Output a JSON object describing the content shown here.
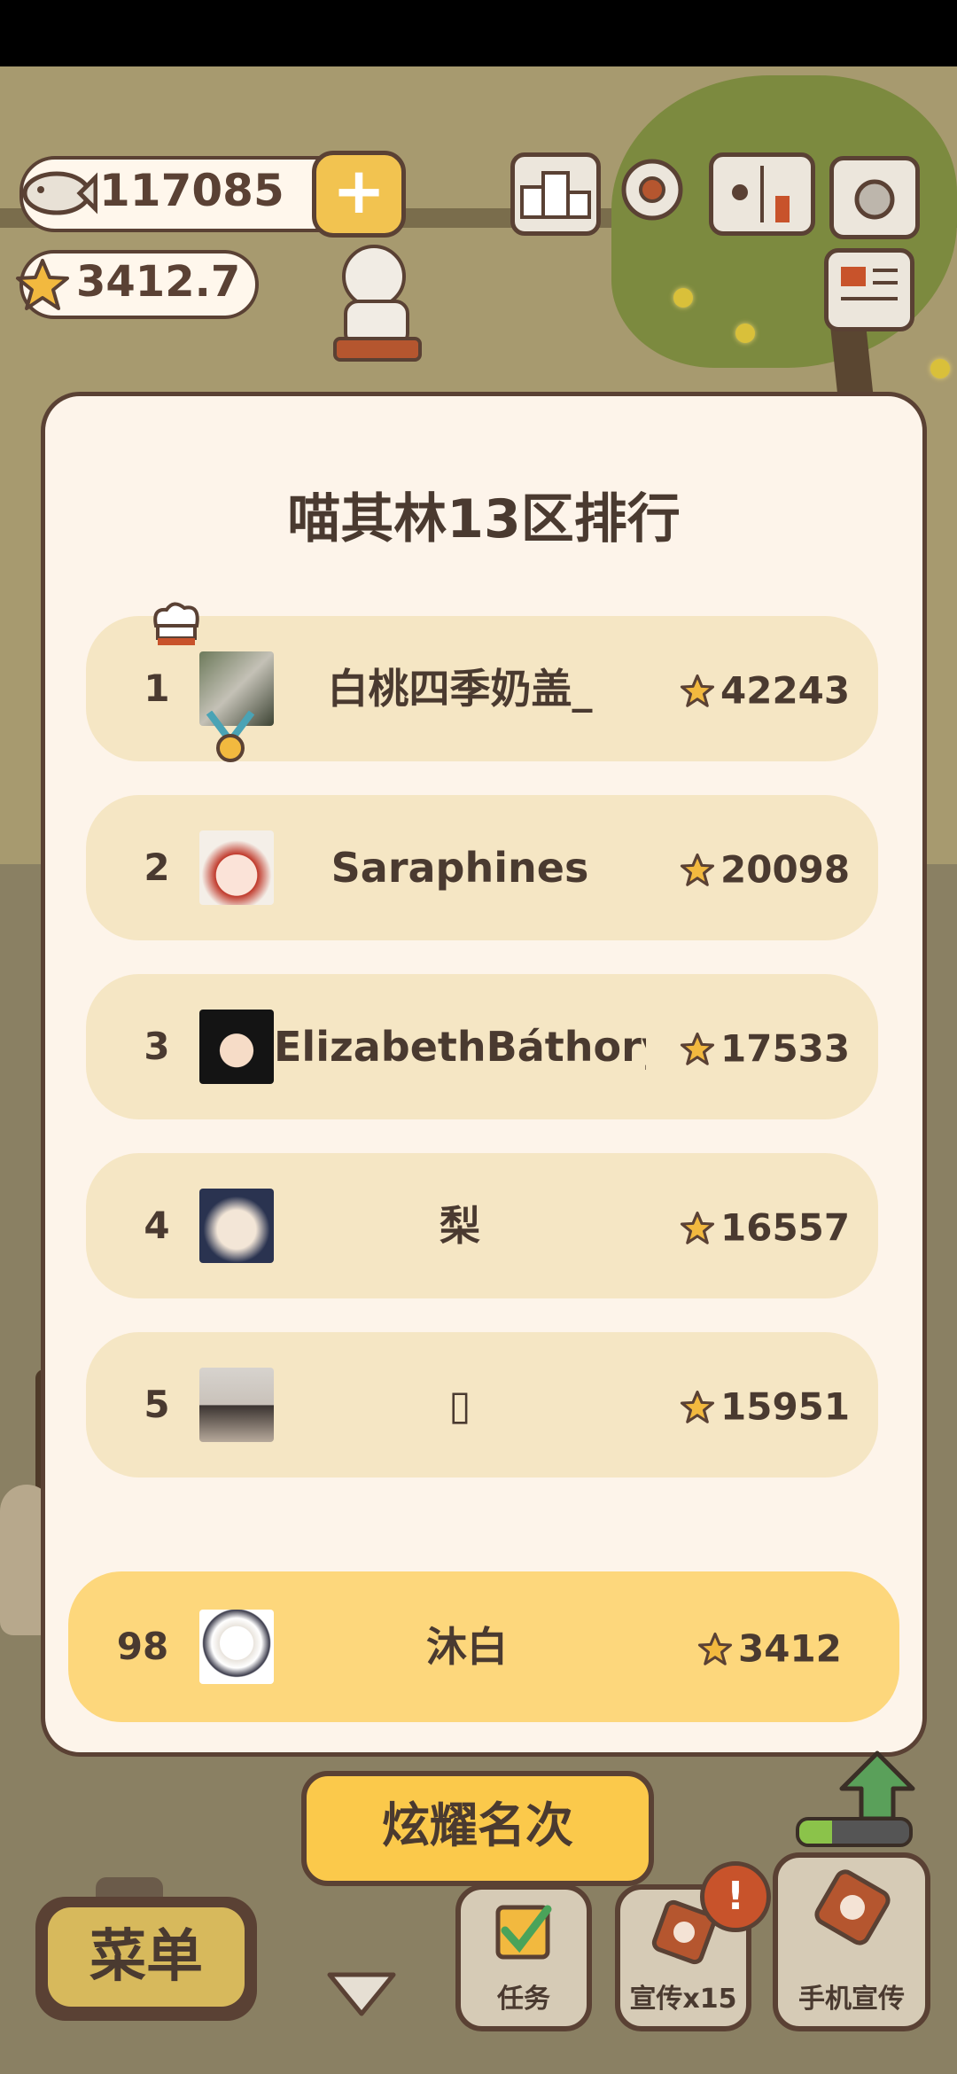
{
  "hud": {
    "fish_count": "117085",
    "star_count": "3412.7",
    "plus_label": "+"
  },
  "ranking": {
    "title": "喵其林13区排行",
    "rows": [
      {
        "rank": "1",
        "name": "白桃四季奶盖_",
        "score": "42243"
      },
      {
        "rank": "2",
        "name": "Saraphines",
        "score": "20098"
      },
      {
        "rank": "3",
        "name": "ElizabethBáthory",
        "score": "17533"
      },
      {
        "rank": "4",
        "name": "梨",
        "score": "16557"
      },
      {
        "rank": "5",
        "name": "▯",
        "score": "15951"
      }
    ],
    "self": {
      "rank": "98",
      "name": "沐白",
      "score": "3412"
    }
  },
  "buttons": {
    "show_rank": "炫耀名次",
    "menu": "菜单",
    "tasks": "任务",
    "promo": "宣传x15",
    "phone_promo": "手机宣传",
    "alert": "!"
  },
  "progress": {
    "level_fraction": 0.3
  },
  "colors": {
    "modal_bg": "#fdf4ea",
    "row_bg": "#f5e6c4",
    "self_row_bg": "#fdd77c",
    "outline": "#5a4134",
    "accent_yellow": "#fbc94b"
  },
  "icons": [
    "fish-icon",
    "plus-icon",
    "star-icon",
    "podium-icon",
    "gear-icon",
    "book-icon",
    "camera-icon",
    "newspaper-icon",
    "crown-icon",
    "medal-icon",
    "checkbox-icon",
    "down-arrow-icon",
    "up-arrow-icon"
  ]
}
